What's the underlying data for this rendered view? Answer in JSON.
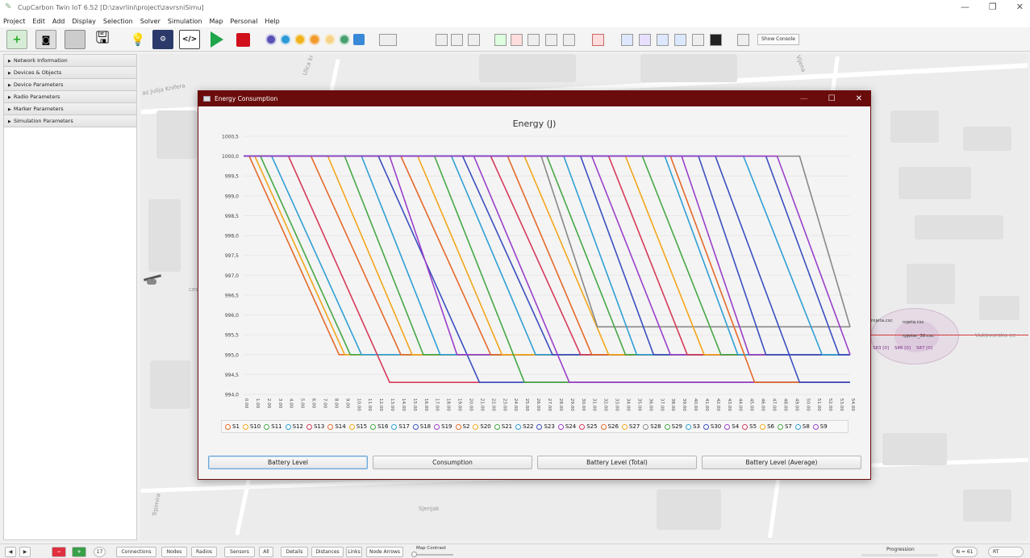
{
  "window": {
    "title": "CupCarbon Twin IoT 6.52 [D:\\zavrlini\\project\\zavrsniSimu]",
    "minimize": "—",
    "maximize": "❐",
    "close": "✕"
  },
  "menu": [
    "Project",
    "Edit",
    "Add",
    "Display",
    "Selection",
    "Solver",
    "Simulation",
    "Map",
    "Personal",
    "Help"
  ],
  "toolbar": {
    "show_console": "Show Console"
  },
  "sidebar": {
    "items": [
      "Network Information",
      "Devices & Objects",
      "Device Parameters",
      "Radio Parameters",
      "Marker Parameters",
      "Simulation Parameters"
    ]
  },
  "map": {
    "labels": [
      "Ulica kr",
      "az Julija Knifera",
      "cesta",
      "Sjenjak",
      "Vijena",
      "Trpimira",
      "Vukovarska ce"
    ],
    "node_labels": [
      "rojeta.csc",
      "rojeta.csc",
      "S83 [0]",
      "S86 [0]",
      "S87 [0]",
      "rpjeter_30.csc"
    ]
  },
  "dialog": {
    "title": "Energy Consumption",
    "minimize": "—",
    "maximize": "☐",
    "close": "✕",
    "buttons": [
      "Battery Level",
      "Consumption",
      "Battery Level (Total)",
      "Battery Level (Average)"
    ]
  },
  "statusbar": {
    "counter": "17",
    "buttons": [
      "Connections",
      "Nodes",
      "Radios",
      "Sensors",
      "All",
      "Details",
      "Distances",
      "Links",
      "Node Arrows"
    ],
    "map_contrast": "Map Contrast",
    "progression": "Progression",
    "n_value": "N = 61",
    "rt": "RT"
  },
  "chart_data": {
    "type": "line",
    "title": "Energy (J)",
    "xlabel": "",
    "ylabel": "",
    "ylim": [
      994.0,
      1000.5
    ],
    "yticks": [
      "1000,5",
      "1000,0",
      "999,5",
      "999,0",
      "998,5",
      "998,0",
      "997,5",
      "997,0",
      "996,5",
      "996,0",
      "995,5",
      "995,0",
      "994,5",
      "994,0"
    ],
    "xticks": [
      "0.00",
      "1.00",
      "2.00",
      "3.00",
      "4.00",
      "5.00",
      "6.00",
      "7.00",
      "8.00",
      "9.00",
      "10.00",
      "11.00",
      "12.00",
      "13.00",
      "14.00",
      "15.00",
      "16.00",
      "17.00",
      "18.00",
      "19.00",
      "20.00",
      "21.00",
      "22.00",
      "23.00",
      "24.00",
      "25.00",
      "26.00",
      "27.00",
      "28.00",
      "29.00",
      "30.00",
      "31.00",
      "32.00",
      "33.00",
      "34.00",
      "35.00",
      "36.00",
      "37.00",
      "38.00",
      "39.00",
      "40.00",
      "41.00",
      "42.00",
      "43.00",
      "44.00",
      "45.00",
      "46.00",
      "47.00",
      "48.00",
      "49.00",
      "50.00",
      "51.00",
      "52.00",
      "53.00",
      "54.00"
    ],
    "series": [
      {
        "name": "S1",
        "color": "#e5692a",
        "start": 0.5,
        "end": 8.5,
        "final": 995.0
      },
      {
        "name": "S10",
        "color": "#f2a61a",
        "start": 1.0,
        "end": 9.0,
        "final": 995.0
      },
      {
        "name": "S11",
        "color": "#45a845",
        "start": 1.5,
        "end": 9.5,
        "final": 995.0
      },
      {
        "name": "S12",
        "color": "#2f9fd4",
        "start": 2.5,
        "end": 10.5,
        "final": 995.0
      },
      {
        "name": "S13",
        "color": "#d63a5a",
        "start": 4.0,
        "end": 13.0,
        "final": 994.3
      },
      {
        "name": "S14",
        "color": "#e5692a",
        "start": 6.0,
        "end": 14.0,
        "final": 995.0
      },
      {
        "name": "S15",
        "color": "#f2a61a",
        "start": 7.5,
        "end": 15.0,
        "final": 995.0
      },
      {
        "name": "S16",
        "color": "#45a845",
        "start": 9.0,
        "end": 16.0,
        "final": 995.0
      },
      {
        "name": "S17",
        "color": "#2f9fd4",
        "start": 10.5,
        "end": 17.5,
        "final": 995.0
      },
      {
        "name": "S18",
        "color": "#3a4fbf",
        "start": 12.0,
        "end": 21.0,
        "final": 994.3
      },
      {
        "name": "S19",
        "color": "#9b3fc9",
        "start": 13.0,
        "end": 19.0,
        "final": 995.0
      },
      {
        "name": "S2",
        "color": "#e5692a",
        "start": 14.0,
        "end": 22.0,
        "final": 995.0
      },
      {
        "name": "S20",
        "color": "#f2a61a",
        "start": 15.5,
        "end": 23.0,
        "final": 995.0
      },
      {
        "name": "S21",
        "color": "#45a845",
        "start": 17.0,
        "end": 25.0,
        "final": 994.3
      },
      {
        "name": "S22",
        "color": "#2f9fd4",
        "start": 18.5,
        "end": 26.0,
        "final": 995.0
      },
      {
        "name": "S23",
        "color": "#3a4fbf",
        "start": 19.5,
        "end": 27.5,
        "final": 995.0
      },
      {
        "name": "S24",
        "color": "#9b3fc9",
        "start": 20.5,
        "end": 29.0,
        "final": 994.3
      },
      {
        "name": "S25",
        "color": "#d63a5a",
        "start": 22.0,
        "end": 30.0,
        "final": 995.0
      },
      {
        "name": "S26",
        "color": "#e5692a",
        "start": 23.5,
        "end": 31.0,
        "final": 995.0
      },
      {
        "name": "S27",
        "color": "#f2a61a",
        "start": 25.0,
        "end": 32.5,
        "final": 995.0
      },
      {
        "name": "S28",
        "color": "#888888",
        "start": 26.5,
        "end": 31.5,
        "final": 995.7
      },
      {
        "name": "S29",
        "color": "#45a845",
        "start": 27.0,
        "end": 34.0,
        "final": 995.0
      },
      {
        "name": "S3",
        "color": "#2f9fd4",
        "start": 28.5,
        "end": 35.0,
        "final": 995.0
      },
      {
        "name": "S30",
        "color": "#3a4fbf",
        "start": 30.0,
        "end": 36.5,
        "final": 995.0
      },
      {
        "name": "S4",
        "color": "#9b3fc9",
        "start": 31.0,
        "end": 38.0,
        "final": 995.0
      },
      {
        "name": "S5",
        "color": "#d63a5a",
        "start": 32.5,
        "end": 39.5,
        "final": 995.0
      },
      {
        "name": "S6",
        "color": "#f2a61a",
        "start": 34.0,
        "end": 41.0,
        "final": 995.0
      },
      {
        "name": "S7",
        "color": "#45a845",
        "start": 35.5,
        "end": 42.5,
        "final": 995.0
      },
      {
        "name": "S8",
        "color": "#2f9fd4",
        "start": 37.5,
        "end": 44.0,
        "final": 995.0
      },
      {
        "name": "S9",
        "color": "#9b3fc9",
        "start": 39.0,
        "end": 45.0,
        "final": 995.0
      }
    ],
    "extra_lines": [
      {
        "color": "#e5692a",
        "start": 38.0,
        "end": 45.5,
        "final": 994.3
      },
      {
        "color": "#3a4fbf",
        "start": 40.5,
        "end": 46.5,
        "final": 995.0
      },
      {
        "color": "#3a4fbf",
        "start": 42.0,
        "end": 49.5,
        "final": 994.3
      },
      {
        "color": "#888888",
        "start": 49.5,
        "end": 54.0,
        "final": 995.7
      },
      {
        "color": "#2f9fd4",
        "start": 44.5,
        "end": 51.5,
        "final": 995.0
      },
      {
        "color": "#3a4fbf",
        "start": 46.5,
        "end": 53.0,
        "final": 995.0
      },
      {
        "color": "#9b3fc9",
        "start": 47.5,
        "end": 54.0,
        "final": 995.0
      }
    ],
    "legend_position": "bottom"
  }
}
